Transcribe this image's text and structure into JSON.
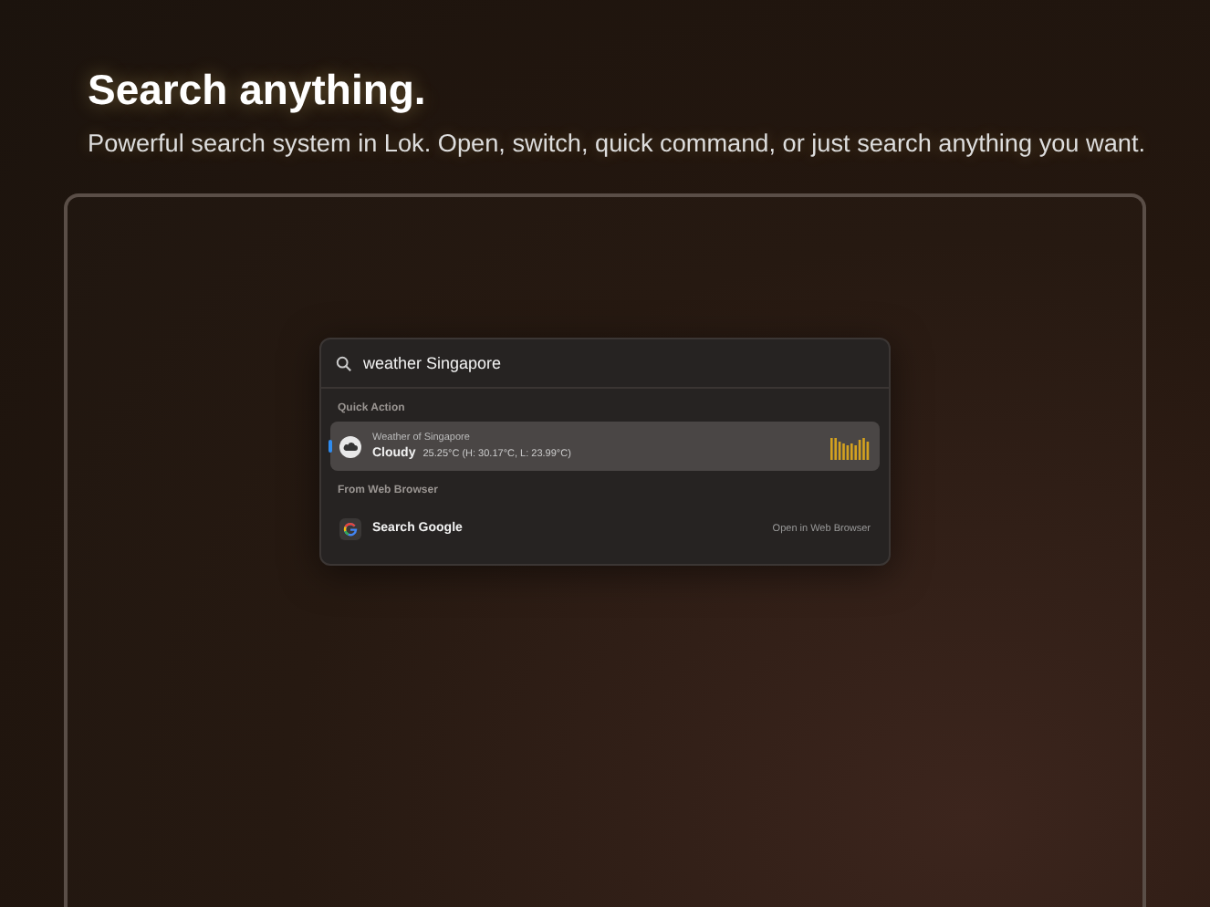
{
  "header": {
    "title": "Search anything.",
    "subtitle": "Powerful search system in Lok. Open, switch, quick command, or just search anything you want."
  },
  "search": {
    "value": "weather Singapore"
  },
  "sections": [
    {
      "heading": "Quick Action",
      "items": [
        {
          "kind": "weather",
          "selected": true,
          "caption": "Weather of Singapore",
          "title": "Cloudy",
          "detail": "25.25°C (H: 30.17°C, L: 23.99°C)"
        }
      ]
    },
    {
      "heading": "From Web Browser",
      "items": [
        {
          "kind": "web",
          "selected": false,
          "title": "Search Google",
          "action": "Open in Web Browser"
        }
      ]
    }
  ]
}
